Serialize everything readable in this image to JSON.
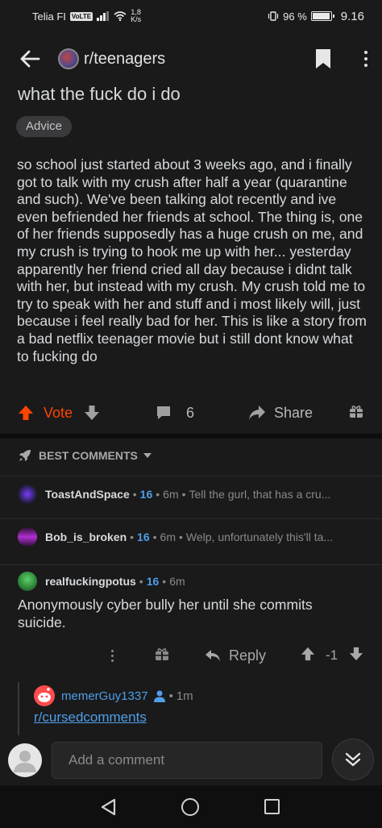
{
  "status_bar": {
    "carrier": "Telia FI",
    "volte": "VoLTE",
    "net_speed_value": "1,8",
    "net_speed_unit": "K/s",
    "battery": "96 %",
    "battery_level": 0.96,
    "time": "9.16"
  },
  "header": {
    "subreddit": "r/teenagers"
  },
  "post": {
    "title": "what the fuck do i do",
    "flair": "Advice",
    "body": "so school just started about 3 weeks ago, and i finally got to talk with my crush after half a year (quarantine and such). We've been talking alot recently and ive even befriended her friends at school. The thing is, one of her friends supposedly has a huge crush on me, and my crush is trying to hook me up with her... yesterday apparently her friend cried all day because i didnt talk with her, but instead with my crush. My crush told me to try to speak with her and stuff and i most likely will, just because i feel really bad for her. This is like a story from a bad netflix teenager movie but i still dont know what to fucking do"
  },
  "actions": {
    "vote_label": "Vote",
    "comment_count": "6",
    "share_label": "Share"
  },
  "sort": {
    "label": "BEST COMMENTS"
  },
  "comments": [
    {
      "user": "ToastAndSpace",
      "score": "16",
      "time": "6m",
      "snippet": "Tell the gurl, that has a cru..."
    },
    {
      "user": "Bob_is_broken",
      "score": "16",
      "time": "6m",
      "snippet": "Welp, unfortunately this'll ta..."
    },
    {
      "user": "realfuckingpotus",
      "score": "16",
      "time": "6m",
      "body": "Anonymously cyber bully her until she commits suicide."
    }
  ],
  "comment_actions": {
    "reply_label": "Reply",
    "score": "-1"
  },
  "nested_reply": {
    "user": "memerGuy1337",
    "time": "1m",
    "link": "r/cursedcomments"
  },
  "comment_bar": {
    "placeholder": "Add a comment"
  },
  "colors": {
    "accent_upvote": "#ff4500",
    "link_blue": "#4f9ee8",
    "background": "#1a1a1b"
  }
}
